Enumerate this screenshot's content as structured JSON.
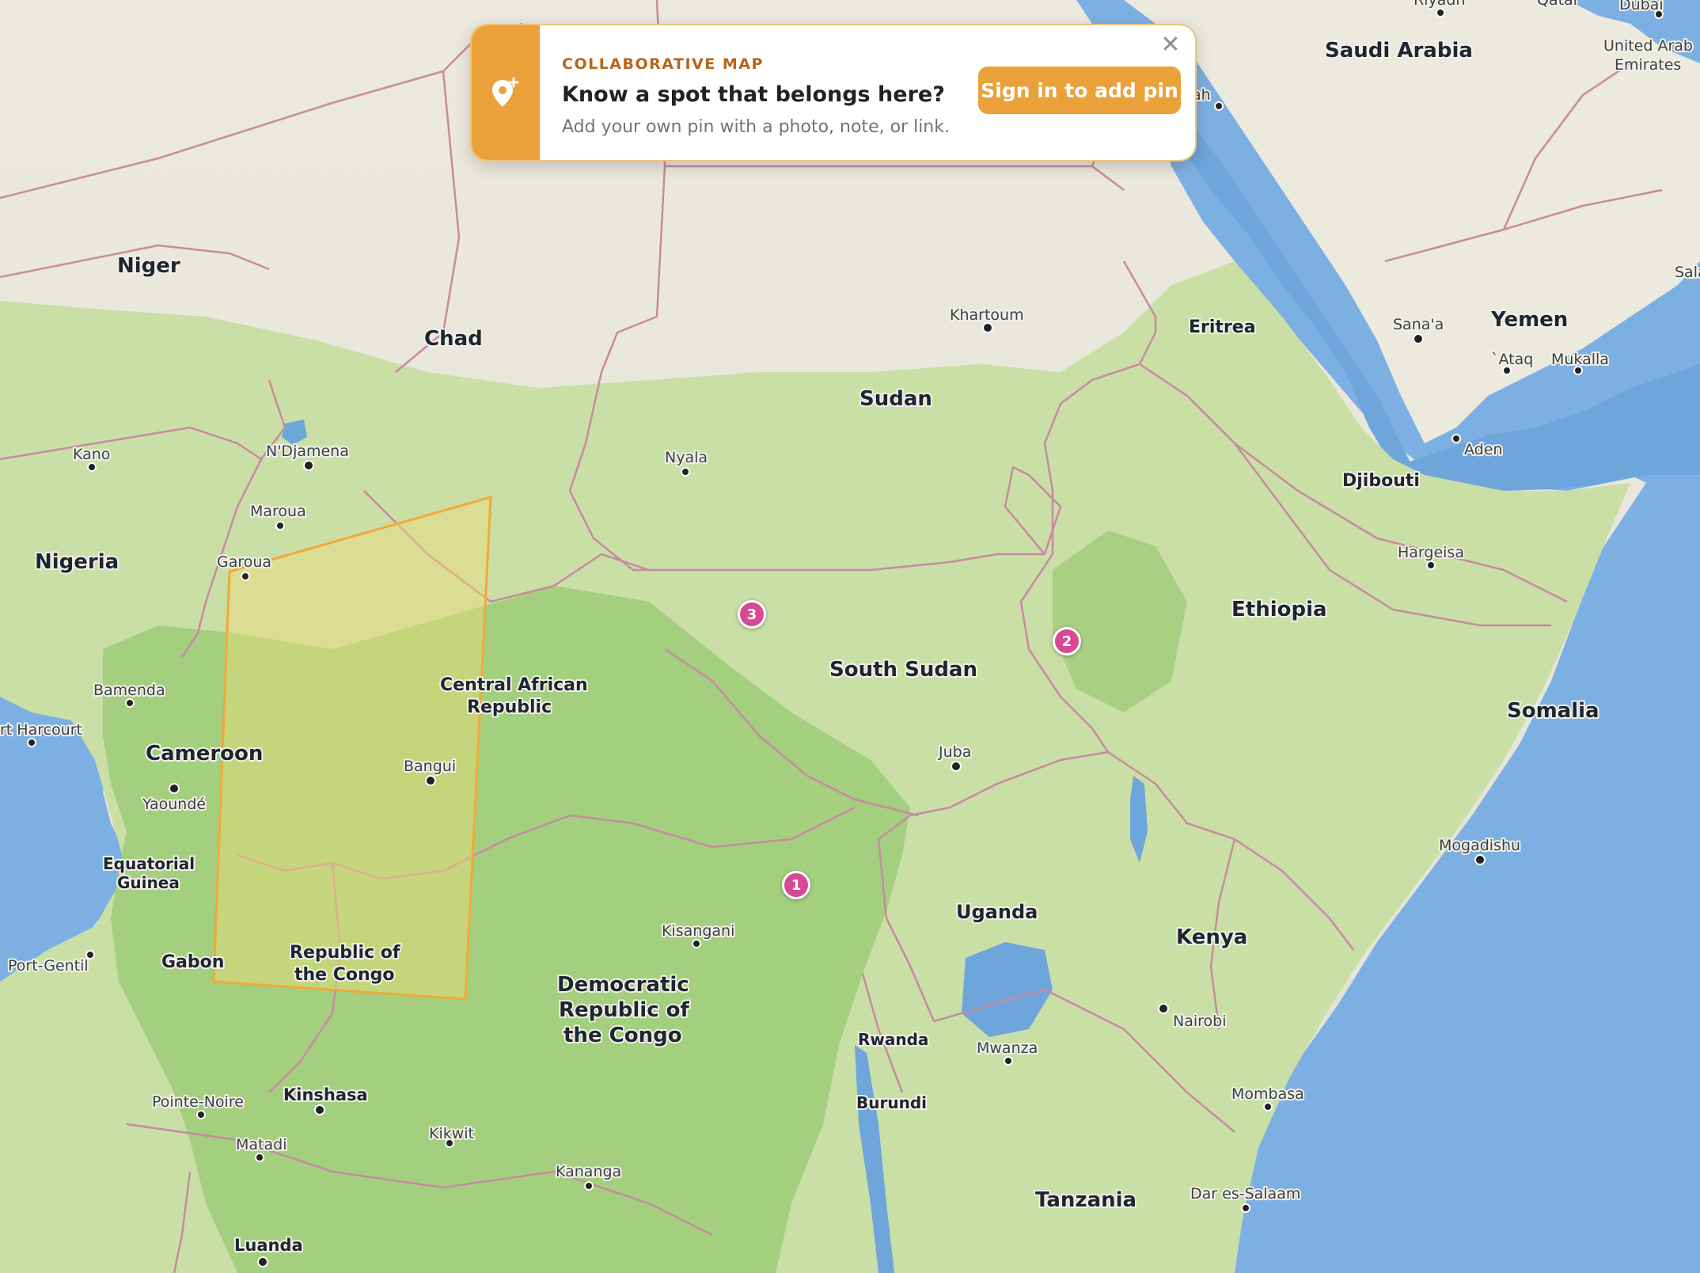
{
  "banner": {
    "eyebrow": "COLLABORATIVE MAP",
    "title": "Know a spot that belongs here?",
    "subtitle": "Add your own pin with a photo, note, or link.",
    "cta": "Sign in to add pin",
    "close_icon": "close-icon",
    "side_icon": "map-pin-plus-icon"
  },
  "colors": {
    "accent": "#eba13a",
    "pin": "#d64a93",
    "selection": "#f2a93b"
  },
  "pins": [
    {
      "label": "1"
    },
    {
      "label": "2"
    },
    {
      "label": "3"
    }
  ],
  "countries": {
    "saudi_arabia": "Saudi Arabia",
    "uae_1": "United Arab",
    "uae_2": "Emirates",
    "niger": "Niger",
    "chad": "Chad",
    "sudan": "Sudan",
    "eritrea": "Eritrea",
    "yemen": "Yemen",
    "djibouti": "Djibouti",
    "nigeria": "Nigeria",
    "ethiopia": "Ethiopia",
    "south_sudan": "South Sudan",
    "car_1": "Central African",
    "car_2": "Republic",
    "somalia": "Somalia",
    "cameroon": "Cameroon",
    "eq_guinea_1": "Equatorial",
    "eq_guinea_2": "Guinea",
    "uganda": "Uganda",
    "kenya": "Kenya",
    "gabon": "Gabon",
    "roc_1": "Republic of",
    "roc_2": "the Congo",
    "drc_1": "Democratic",
    "drc_2": "Republic of",
    "drc_3": "the Congo",
    "rwanda": "Rwanda",
    "burundi": "Burundi",
    "tanzania": "Tanzania",
    "qatar": "Qatar"
  },
  "cities": {
    "riyadh": "Riyadh",
    "dubai": "Dubai",
    "jeddah": "ah",
    "khartoum": "Khartoum",
    "sanaa": "Sana'a",
    "ataq": "`Ataq",
    "mukalla": "Mukalla",
    "aden": "Aden",
    "kano": "Kano",
    "ndjamena": "N'Djamena",
    "nyala": "Nyala",
    "maroua": "Maroua",
    "garoua": "Garoua",
    "hargeisa": "Hargeisa",
    "bamenda": "Bamenda",
    "port_harcourt": "rt Harcourt",
    "bangui": "Bangui",
    "juba": "Juba",
    "yaounde": "Yaoundé",
    "mogadishu": "Mogadishu",
    "kisangani": "Kisangani",
    "port_gentil": "Port-Gentil",
    "nairobi": "Nairobi",
    "mwanza": "Mwanza",
    "pointe_noire": "Pointe-Noire",
    "kinshasa": "Kinshasa",
    "mombasa": "Mombasa",
    "kikwit": "Kikwit",
    "matadi": "Matadi",
    "kananga": "Kananga",
    "dar_es_salaam": "Dar es-Salaam",
    "luanda": "Luanda",
    "sala": "Sala"
  }
}
